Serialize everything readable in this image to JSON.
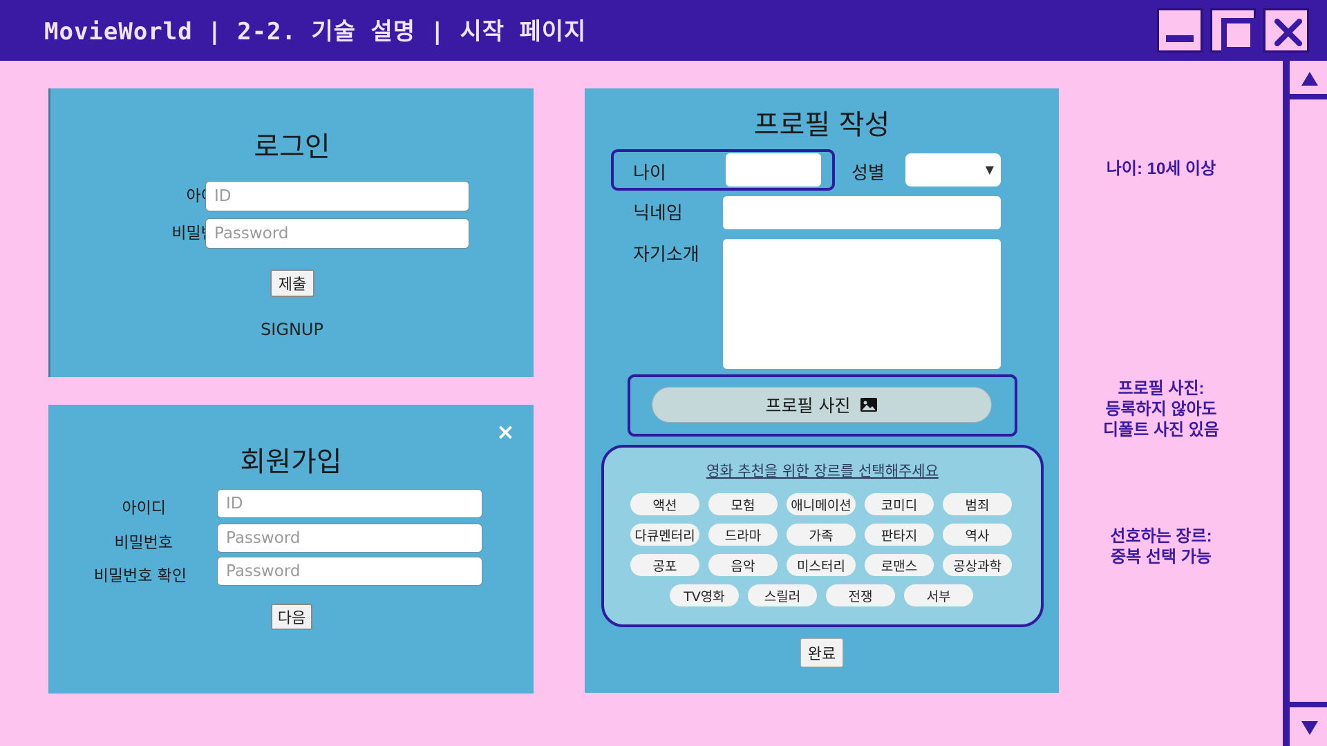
{
  "titlebar": {
    "title": "MovieWorld | 2-2. 기술 설명 | 시작 페이지"
  },
  "login": {
    "heading": "로그인",
    "id_label": "아이디",
    "id_placeholder": "ID",
    "pw_label": "비밀번호",
    "pw_placeholder": "Password",
    "submit": "제출",
    "signup_link": "SIGNUP"
  },
  "signup": {
    "heading": "회원가입",
    "close": "×",
    "id_label": "아이디",
    "id_placeholder": "ID",
    "pw_label": "비밀번호",
    "pw_placeholder": "Password",
    "pw_confirm_label": "비밀번호 확인",
    "pw_confirm_placeholder": "Password",
    "next": "다음"
  },
  "profile": {
    "heading": "프로필 작성",
    "age_label": "나이",
    "gender_label": "성별",
    "nickname_label": "닉네임",
    "intro_label": "자기소개",
    "photo_button": "프로필 사진",
    "genre_title": "영화 추천을 위한 장르를 선택해주세요",
    "genres": [
      "액션",
      "모험",
      "애니메이션",
      "코미디",
      "범죄",
      "다큐멘터리",
      "드라마",
      "가족",
      "판타지",
      "역사",
      "공포",
      "음악",
      "미스터리",
      "로맨스",
      "공상과학",
      "TV영화",
      "스릴러",
      "전쟁",
      "서부"
    ],
    "done": "완료"
  },
  "notes": {
    "age": "나이: 10세 이상",
    "photo_1": "프로필 사진:",
    "photo_2": "등록하지 않아도",
    "photo_3": "디폴트 사진 있음",
    "genre_1": "선호하는 장르:",
    "genre_2": "중복 선택 가능"
  },
  "colors": {
    "titlebar": "#3b1aa3",
    "background": "#fdc4ef",
    "panel": "#56b0d6",
    "highlight": "#2d1c9e"
  }
}
